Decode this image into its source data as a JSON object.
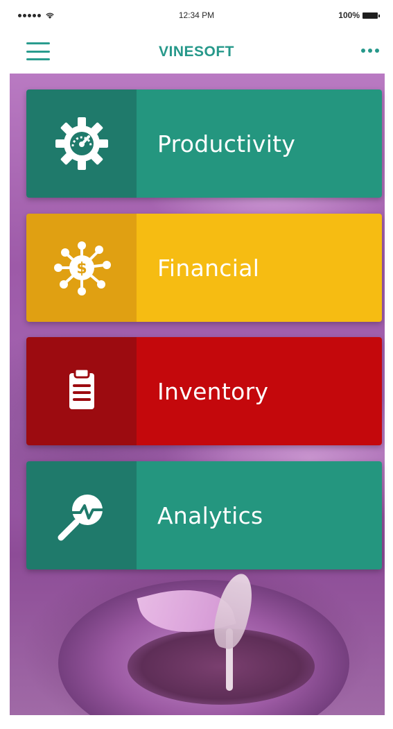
{
  "status_bar": {
    "time": "12:34 PM",
    "battery": "100%"
  },
  "nav": {
    "title": "VINESOFT"
  },
  "tiles": [
    {
      "label": "Productivity",
      "icon": "gear-gauge-icon",
      "icon_bg": "#1f7a6b",
      "label_bg": "#24967f"
    },
    {
      "label": "Financial",
      "icon": "money-network-icon",
      "icon_bg": "#e0a012",
      "label_bg": "#f6bc12"
    },
    {
      "label": "Inventory",
      "icon": "clipboard-icon",
      "icon_bg": "#9c0b10",
      "label_bg": "#c4080c"
    },
    {
      "label": "Analytics",
      "icon": "magnifier-chart-icon",
      "icon_bg": "#1f7a6b",
      "label_bg": "#24967f"
    }
  ]
}
